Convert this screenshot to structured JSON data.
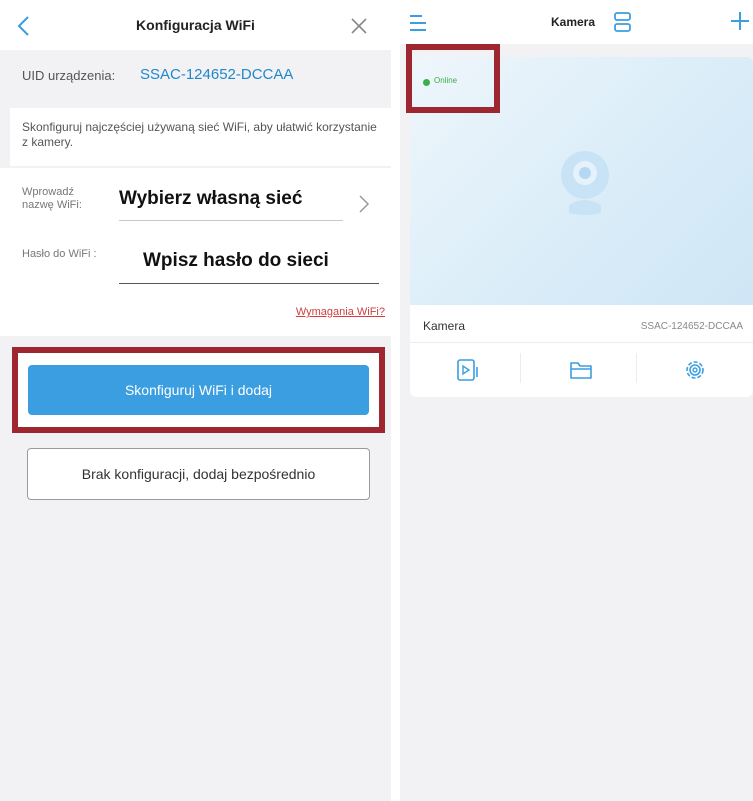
{
  "left": {
    "header": {
      "title": "Konfiguracja WiFi"
    },
    "device": {
      "uid_label": "UID urządzenia:",
      "uid_value": "SSAC-124652-DCCAA"
    },
    "info_text": "Skonfiguruj najczęściej używaną sieć WiFi, aby ułatwić korzystanie z kamery.",
    "form": {
      "ssid_label": "Wprowadź nazwę WiFi:",
      "ssid_value": "Wybierz własną sieć",
      "password_label": "Hasło do WiFi :",
      "password_value": "Wpisz hasło do sieci",
      "requirements_link": "Wymagania WiFi?"
    },
    "buttons": {
      "configure": "Skonfiguruj WiFi i dodaj",
      "add_direct": "Brak konfiguracji, dodaj bezpośrednio"
    }
  },
  "right": {
    "header": {
      "title": "Kamera"
    },
    "card": {
      "status": "Online",
      "name": "Kamera",
      "uid": "SSAC-124652-DCCAA"
    }
  },
  "colors": {
    "accent": "#3a9ee0",
    "uid_text": "#1f88c9",
    "highlight_border": "#9e2630",
    "online_green": "#3cae4a",
    "link_red": "#d04040"
  },
  "icons": [
    "back-arrow-icon",
    "close-icon",
    "chevron-right-icon",
    "menu-icon",
    "layout-icon",
    "plus-icon",
    "camera-icon",
    "playback-icon",
    "folder-icon",
    "gear-icon"
  ]
}
